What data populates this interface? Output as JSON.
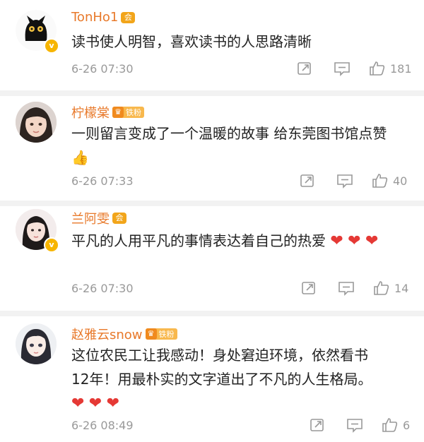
{
  "comments": [
    {
      "username": "TonHo1",
      "vip": "会",
      "text": "读书使人明智，喜欢读书的人思路清晰",
      "time": "6-26 07:30",
      "likes": "181"
    },
    {
      "username": "柠檬棠",
      "fan_badge": "铁粉",
      "text": "一则留言变成了一个温暖的故事  给东莞图书馆点赞",
      "emoji": "👍",
      "time": "6-26 07:33",
      "likes": "40"
    },
    {
      "username": "兰阿雯",
      "vip": "会",
      "text": "平凡的人用平凡的事情表达着自己的热爱",
      "time": "6-26 07:30",
      "likes": "14"
    },
    {
      "username": "赵雅云snow",
      "fan_badge": "铁粉",
      "text_line1": "这位农民工让我感动！身处窘迫环境，依然看书",
      "text_line2": "12年！用最朴实的文字道出了不凡的人生格局。",
      "time": "6-26 08:49",
      "likes": "6"
    }
  ],
  "icons": {
    "share": "share-icon",
    "comment": "comment-icon",
    "like": "thumbs-up-icon",
    "heart": "heart-emoji"
  },
  "colors": {
    "username": "#e8792a",
    "heart": "#e53935",
    "meta": "#999999"
  }
}
